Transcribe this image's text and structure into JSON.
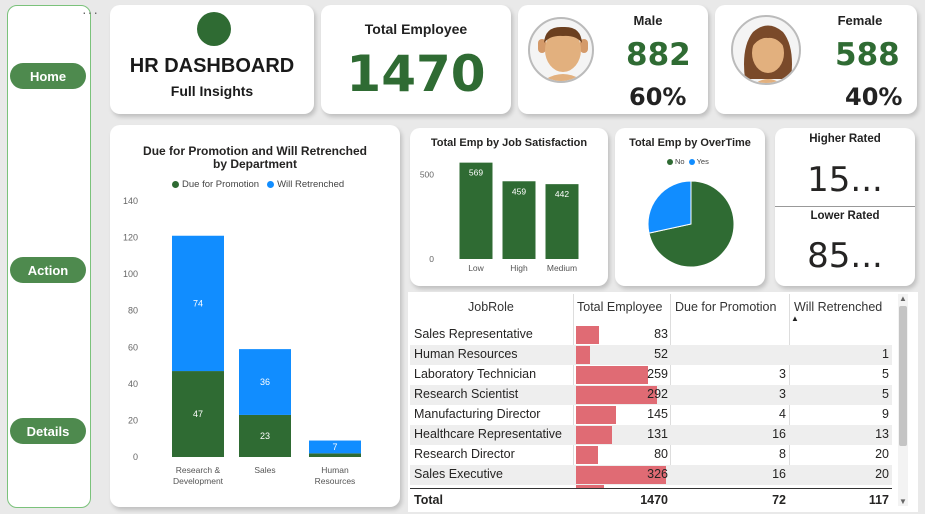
{
  "sidebar": {
    "more": "···",
    "items": [
      {
        "label": "Home"
      },
      {
        "label": "Action"
      },
      {
        "label": "Details"
      }
    ]
  },
  "header": {
    "title": "HR DASHBOARD",
    "subtitle": "Full Insights"
  },
  "kpis": {
    "total_label": "Total Employee",
    "total_value": "1470",
    "male_label": "Male",
    "male_value": "882",
    "male_pct": "60%",
    "female_label": "Female",
    "female_value": "588",
    "female_pct": "40%",
    "higher_label": "Higher Rated",
    "higher_value": "15...",
    "lower_label": "Lower Rated",
    "lower_value": "85..."
  },
  "colors": {
    "green": "#2f6b33",
    "blue": "#118dff",
    "table_bar": "#e06b74",
    "nav_button": "#4e8a4e"
  },
  "chart_data": [
    {
      "type": "bar",
      "stacked": true,
      "title": "Due for Promotion and Will Retrenched by Department",
      "categories": [
        "Research & Development",
        "Sales",
        "Human Resources"
      ],
      "series": [
        {
          "name": "Due for Promotion",
          "values": [
            47,
            23,
            2
          ],
          "labels": [
            "47",
            "23",
            ""
          ]
        },
        {
          "name": "Will Retrenched",
          "values": [
            74,
            36,
            7
          ],
          "labels": [
            "74",
            "36",
            "7"
          ]
        }
      ],
      "ylim": [
        0,
        140
      ],
      "yticks": [
        "0",
        "20",
        "40",
        "60",
        "80",
        "100",
        "120",
        "140"
      ],
      "legend": "top-center",
      "grid": false
    },
    {
      "type": "bar",
      "title": "Total Emp by Job Satisfaction",
      "categories": [
        "Low",
        "High",
        "Medium"
      ],
      "values": [
        569,
        459,
        442
      ],
      "yticks": [
        "0",
        "500"
      ],
      "ylim": [
        0,
        620
      ]
    },
    {
      "type": "pie",
      "title": "Total Emp by OverTime",
      "labels": [
        "No",
        "Yes"
      ],
      "values": [
        71.6,
        28.4
      ],
      "legend": "top-center"
    }
  ],
  "table": {
    "headers": [
      "JobRole",
      "Total Employee",
      "Due for Promotion",
      "Will Retrenched"
    ],
    "sort_indicator": "▲",
    "rows": [
      {
        "role": "Sales Representative",
        "total": "83",
        "total_value": 83,
        "promo": "",
        "retr": ""
      },
      {
        "role": "Human Resources",
        "total": "52",
        "total_value": 52,
        "promo": "",
        "retr": "1"
      },
      {
        "role": "Laboratory Technician",
        "total": "259",
        "total_value": 259,
        "promo": "3",
        "retr": "5"
      },
      {
        "role": "Research Scientist",
        "total": "292",
        "total_value": 292,
        "promo": "3",
        "retr": "5"
      },
      {
        "role": "Manufacturing Director",
        "total": "145",
        "total_value": 145,
        "promo": "4",
        "retr": "9"
      },
      {
        "role": "Healthcare Representative",
        "total": "131",
        "total_value": 131,
        "promo": "16",
        "retr": "13"
      },
      {
        "role": "Research Director",
        "total": "80",
        "total_value": 80,
        "promo": "8",
        "retr": "20"
      },
      {
        "role": "Sales Executive",
        "total": "326",
        "total_value": 326,
        "promo": "16",
        "retr": "20"
      }
    ],
    "total": {
      "label": "Total",
      "total": "1470",
      "promo": "72",
      "retr": "117"
    }
  }
}
